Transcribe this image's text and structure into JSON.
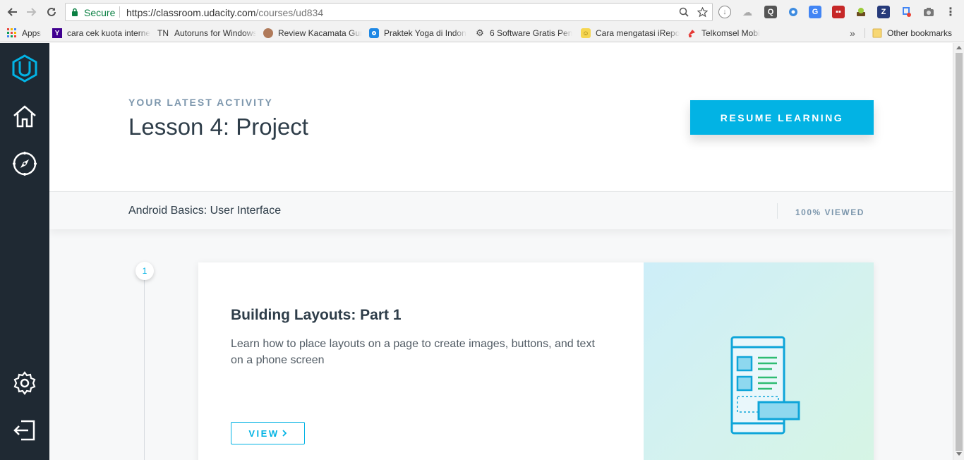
{
  "browser": {
    "secure_label": "Secure",
    "url_host": "https://classroom.udacity.com",
    "url_path": "/courses/ud834",
    "bookmarks": [
      {
        "label": "Apps",
        "icon": "apps-grid-icon"
      },
      {
        "label": "cara cek kuota interne",
        "icon": "yahoo-icon"
      },
      {
        "label": "Autoruns for Windows",
        "icon": "tn-icon",
        "prefix": "TN"
      },
      {
        "label": "Review Kacamata Gur",
        "icon": "avatar-icon"
      },
      {
        "label": "Praktek Yoga di Indon",
        "icon": "blue-square-icon"
      },
      {
        "label": "6 Software Gratis Pen",
        "icon": "gear-favicon"
      },
      {
        "label": "Cara mengatasi iRepo",
        "icon": "yellow-face-icon"
      },
      {
        "label": "Telkomsel Mobi",
        "icon": "telkomsel-icon"
      }
    ],
    "overflow_label": "»",
    "other_bookmarks": "Other bookmarks"
  },
  "sidebar": {
    "items": [
      {
        "name": "udacity-logo-icon"
      },
      {
        "name": "home-icon"
      },
      {
        "name": "compass-icon"
      },
      {
        "name": "settings-gear-icon"
      },
      {
        "name": "logout-icon"
      }
    ]
  },
  "hero": {
    "eyebrow": "YOUR LATEST ACTIVITY",
    "title": "Lesson 4: Project",
    "resume_label": "RESUME LEARNING"
  },
  "course": {
    "name": "Android Basics: User Interface",
    "progress_label": "100% VIEWED",
    "progress_value": 100
  },
  "lessons": [
    {
      "number": "1",
      "title": "Building Layouts: Part 1",
      "description": "Learn how to place layouts on a page to create images, buttons, and text on a phone screen",
      "view_label": "VIEW",
      "illustration": "phone-layout-illustration"
    }
  ],
  "colors": {
    "accent": "#02b3e4",
    "sidebar": "#1f2933",
    "text_dark": "#2e3d49",
    "text_muted": "#7d97ad"
  }
}
